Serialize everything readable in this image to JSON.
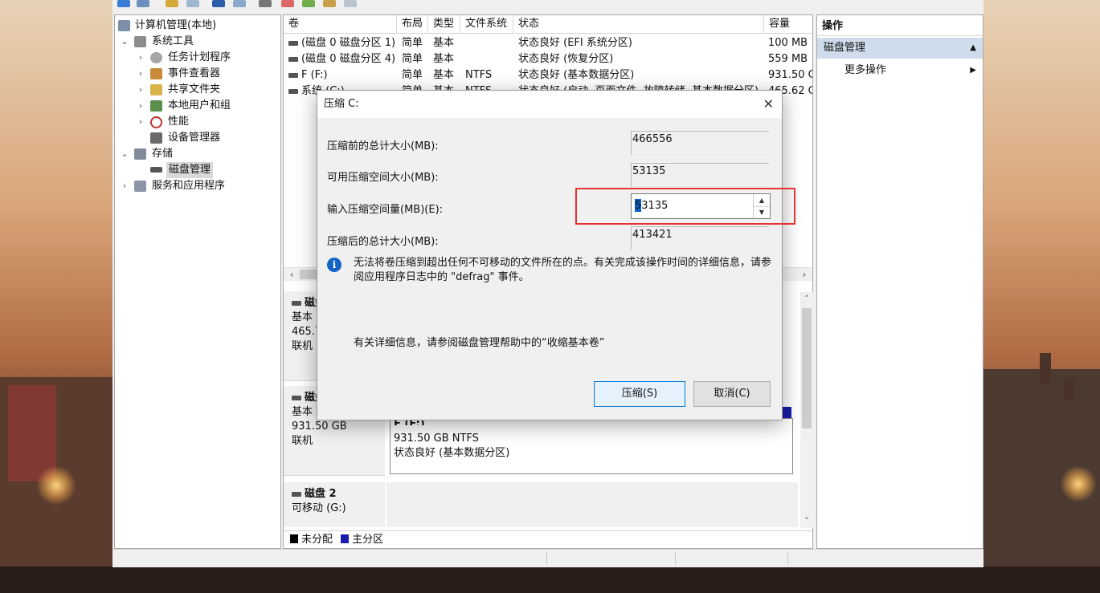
{
  "colors": {
    "unallocated": "#000000",
    "primary_partition": "#1a1aa8",
    "highlight_box": "#e53333",
    "info_icon": "#1464c8",
    "selected_section": "#cfdcec"
  },
  "tree": {
    "items": [
      {
        "label": "计算机管理(本地)",
        "icon": "computer-management-icon",
        "arrow": ""
      },
      {
        "label": "系统工具",
        "icon": "system-tools-icon",
        "arrow": "⌄"
      },
      {
        "label": "任务计划程序",
        "icon": "task-scheduler-icon",
        "arrow": "›"
      },
      {
        "label": "事件查看器",
        "icon": "event-viewer-icon",
        "arrow": "›"
      },
      {
        "label": "共享文件夹",
        "icon": "shared-folders-icon",
        "arrow": "›"
      },
      {
        "label": "本地用户和组",
        "icon": "local-users-icon",
        "arrow": "›"
      },
      {
        "label": "性能",
        "icon": "performance-icon",
        "arrow": "›"
      },
      {
        "label": "设备管理器",
        "icon": "device-manager-icon",
        "arrow": ""
      },
      {
        "label": "存储",
        "icon": "storage-icon",
        "arrow": "⌄"
      },
      {
        "label": "磁盘管理",
        "icon": "disk-management-icon",
        "arrow": ""
      },
      {
        "label": "服务和应用程序",
        "icon": "services-apps-icon",
        "arrow": "›"
      }
    ]
  },
  "volumes": {
    "columns": [
      "卷",
      "布局",
      "类型",
      "文件系统",
      "状态",
      "容量"
    ],
    "rows": [
      [
        "(磁盘 0 磁盘分区 1)",
        "简单",
        "基本",
        "",
        "状态良好 (EFI 系统分区)",
        "100 MB"
      ],
      [
        "(磁盘 0 磁盘分区 4)",
        "简单",
        "基本",
        "",
        "状态良好 (恢复分区)",
        "559 MB"
      ],
      [
        "F (F:)",
        "简单",
        "基本",
        "NTFS",
        "状态良好 (基本数据分区)",
        "931.50 G"
      ],
      [
        "系统 (C:)",
        "简单",
        "基本",
        "NTFS",
        "状态良好 (启动, 页面文件, 故障转储, 基本数据分区)",
        "465.62 G"
      ]
    ]
  },
  "disks": {
    "disk0": {
      "name": "磁盘",
      "type": "基本",
      "size": "465.7",
      "status": "联机"
    },
    "disk1": {
      "name": "磁盘",
      "type": "基本",
      "size": "931.50 GB",
      "status": "联机",
      "partition": {
        "title": "F (F:)",
        "size": "931.50 GB NTFS",
        "status": "状态良好 (基本数据分区)"
      }
    },
    "disk2": {
      "name": "磁盘 2",
      "type": "可移动 (G:)"
    }
  },
  "legend": {
    "unallocated": "未分配",
    "primary": "主分区"
  },
  "actions": {
    "title": "操作",
    "section": "磁盘管理",
    "more": "更多操作"
  },
  "dialog": {
    "title": "压缩 C:",
    "total_before_label": "压缩前的总计大小(MB):",
    "total_before_value": "466556",
    "available_label": "可用压缩空间大小(MB):",
    "available_value": "53135",
    "input_label": "输入压缩空间量(MB)(E):",
    "input_value": "53135",
    "total_after_label": "压缩后的总计大小(MB):",
    "total_after_value": "413421",
    "info_text": "无法将卷压缩到超出任何不可移动的文件所在的点。有关完成该操作时间的详细信息，请参阅应用程序日志中的 \"defrag\" 事件。",
    "help_text": "有关详细信息，请参阅磁盘管理帮助中的“收缩基本卷”",
    "shrink_button": "压缩(S)",
    "cancel_button": "取消(C)"
  }
}
